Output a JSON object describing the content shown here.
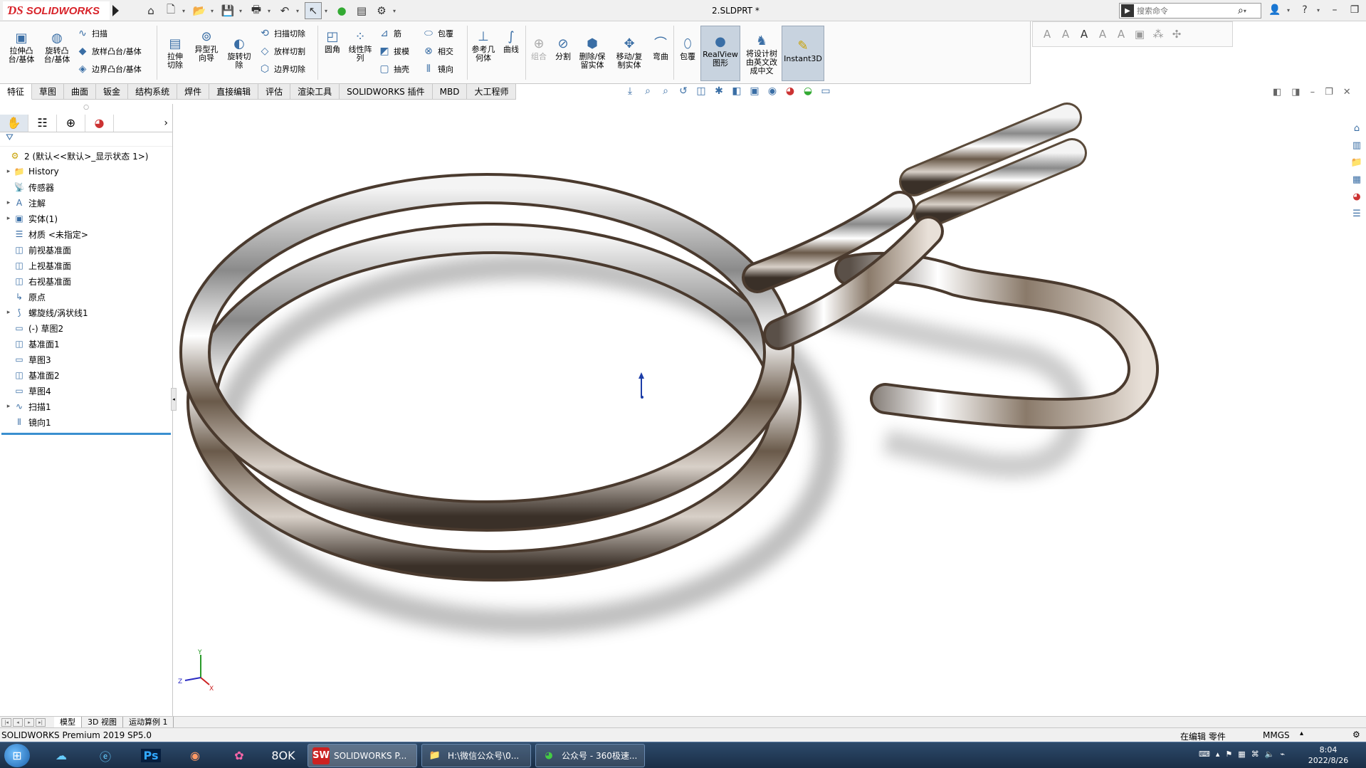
{
  "app": {
    "brand_ds": "𝟹S",
    "brand_name": "SOLIDWORKS",
    "doc_title": "2.SLDPRT *",
    "search_placeholder": "搜索命令"
  },
  "ribbon": {
    "extrude_boss": "拉伸凸台/基体",
    "revolve_boss": "旋转凸台/基体",
    "sweep": "扫描",
    "loft_boss": "放样凸台/基体",
    "boundary_boss": "边界凸台/基体",
    "extrude_cut": "拉伸切除",
    "hole_wizard": "异型孔向导",
    "revolve_cut": "旋转切除",
    "swept_cut": "扫描切除",
    "lofted_cut": "放样切割",
    "boundary_cut": "边界切除",
    "fillet": "圆角",
    "linear_pattern": "线性阵列",
    "rib": "筋",
    "draft": "拔模",
    "shell": "抽壳",
    "wrap": "包覆",
    "intersect": "相交",
    "mirror": "镜向",
    "ref_geometry": "参考几何体",
    "curves": "曲线",
    "combine": "组合",
    "split": "分割",
    "delete_keep": "删除/保留实体",
    "move_copy": "移动/复制实体",
    "flex": "弯曲",
    "wrap2": "包覆",
    "realview": "RealView图形",
    "translate_tree": "将设计树由英文改成中文",
    "instant3d": "Instant3D"
  },
  "tabs": [
    "特征",
    "草图",
    "曲面",
    "钣金",
    "结构系统",
    "焊件",
    "直接编辑",
    "评估",
    "渲染工具",
    "SOLIDWORKS 插件",
    "MBD",
    "大工程师"
  ],
  "tree": {
    "root": "2  (默认<<默认>_显示状态 1>)",
    "items": [
      "History",
      "传感器",
      "注解",
      "实体(1)",
      "材质 <未指定>",
      "前视基准面",
      "上视基准面",
      "右视基准面",
      "原点",
      "螺旋线/涡状线1",
      "(-) 草图2",
      "基准面1",
      "草图3",
      "基准面2",
      "草图4",
      "扫描1",
      "镜向1"
    ]
  },
  "bottom_tabs": [
    "模型",
    "3D 视图",
    "运动算例 1"
  ],
  "status": {
    "product": "SOLIDWORKS Premium 2019 SP5.0",
    "editing": "在编辑 零件",
    "units": "MMGS"
  },
  "taskbar": {
    "sw_window": "SOLIDWORKS P...",
    "folder_window": "H:\\微信公众号\\0...",
    "browser_window": "公众号 - 360极速...",
    "time": "8:04",
    "date": "2022/8/26"
  },
  "triad": {
    "x": "X",
    "y": "Y",
    "z": "Z"
  }
}
